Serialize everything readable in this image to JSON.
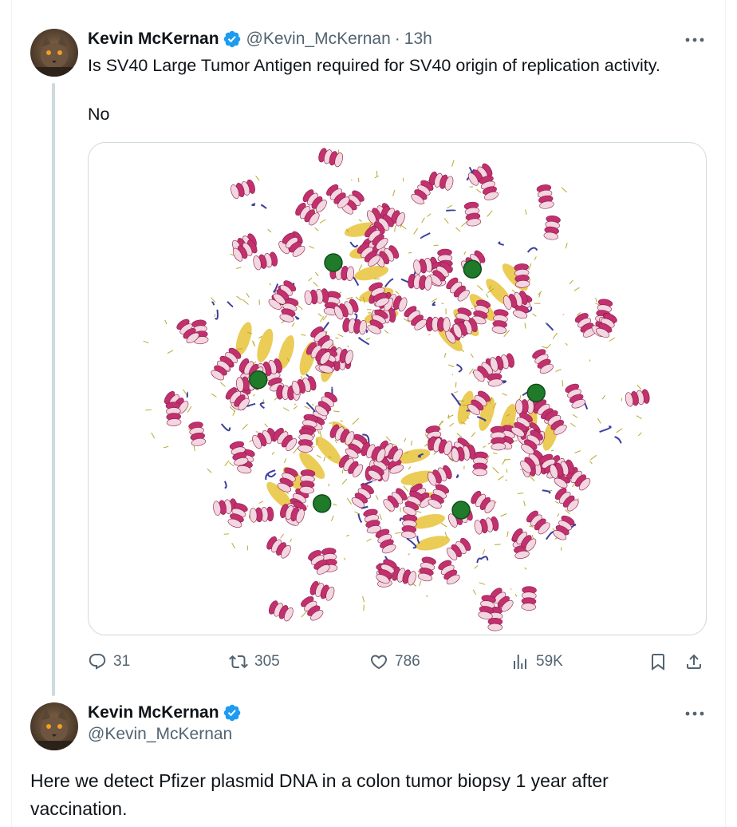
{
  "tweet1": {
    "display_name": "Kevin McKernan",
    "handle": "@Kevin_McKernan",
    "separator": "·",
    "time": "13h",
    "text_line1": "Is SV40 Large Tumor Antigen required for SV40 origin of replication activity.",
    "text_line2": "No",
    "stats": {
      "replies": "31",
      "reposts": "305",
      "likes": "786",
      "views": "59K"
    }
  },
  "tweet2": {
    "display_name": "Kevin McKernan",
    "handle": "@Kevin_McKernan",
    "text_line1": "Here we detect Pfizer plasmid DNA in a colon tumor biopsy 1 year after",
    "text_line2": "vaccination."
  },
  "colors": {
    "verified_blue": "#1d9bf0",
    "secondary_text": "#536471",
    "helix_magenta": "#c2306e",
    "sheet_yellow": "#e8c33a",
    "coil_blue": "#3b3f9e",
    "ion_green": "#1f7a2a"
  },
  "icons": {
    "reply": "speech-bubble-icon",
    "repost": "repost-arrows-icon",
    "like": "heart-icon",
    "views": "bar-chart-icon",
    "bookmark": "bookmark-icon",
    "share": "share-upload-icon",
    "more": "ellipsis-icon",
    "verified": "verified-badge-icon"
  }
}
